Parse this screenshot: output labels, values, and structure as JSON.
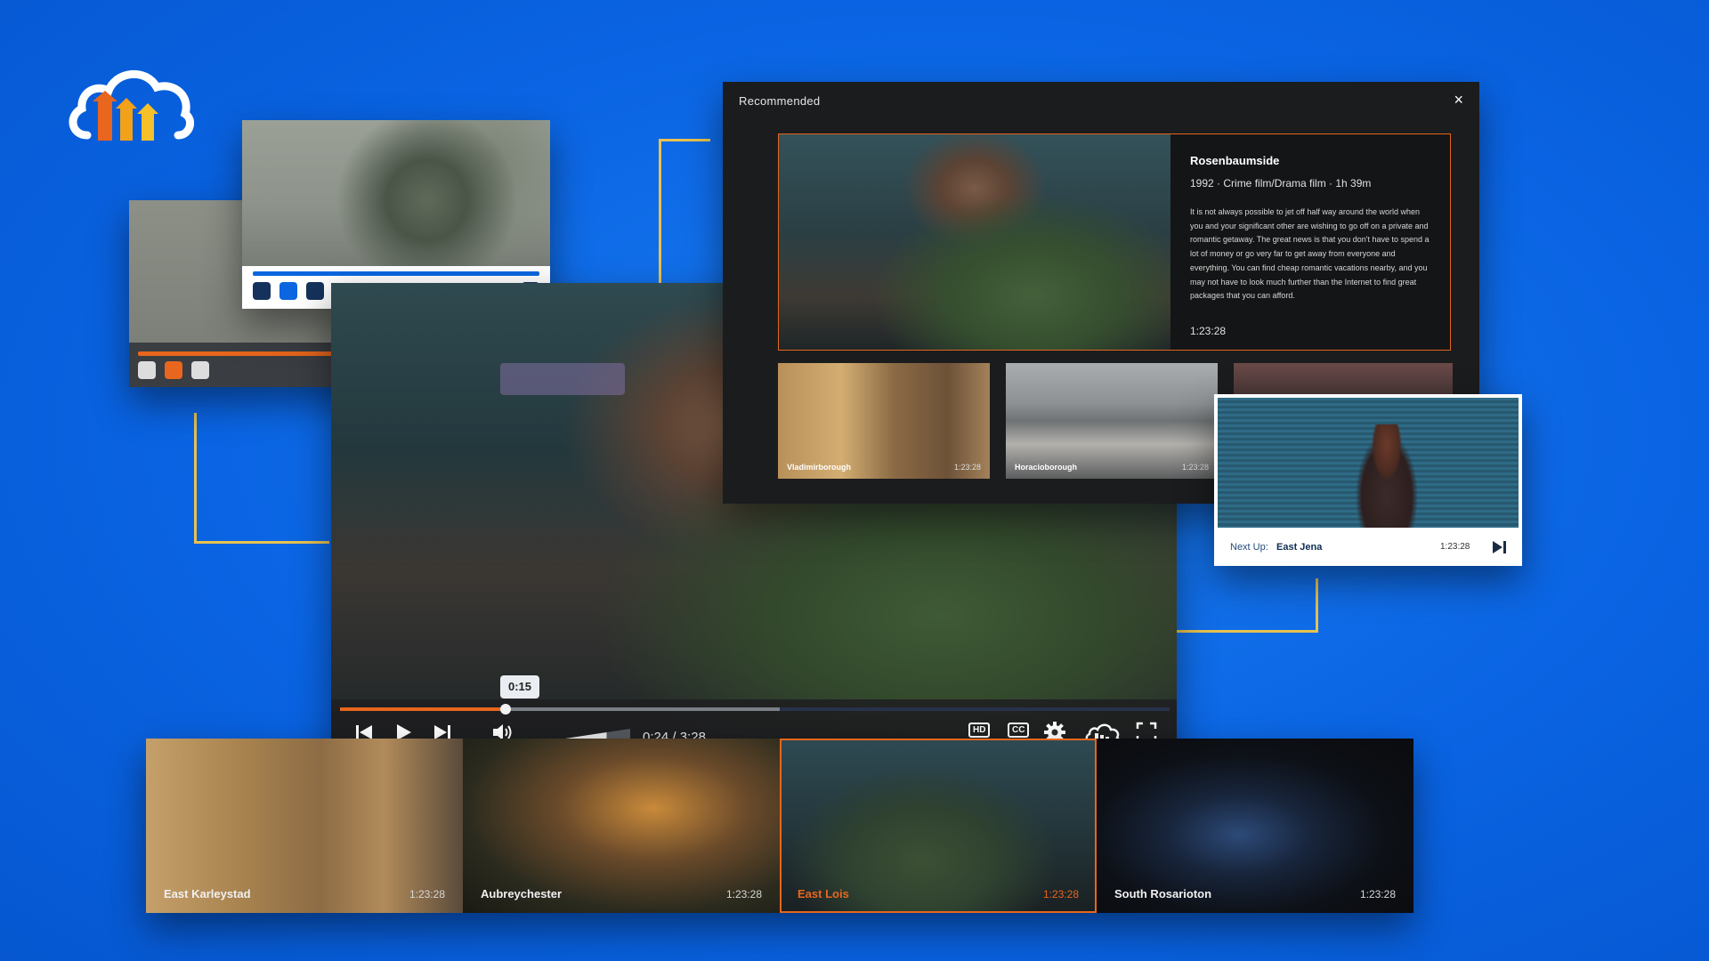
{
  "colors": {
    "background": "#0a64e3",
    "accent_orange": "#e8661d",
    "accent_blue": "#0b66e0",
    "connector_line": "#e8c24f",
    "panel_dark": "#1b1c1e"
  },
  "main_player": {
    "scrub_tooltip": "0:15",
    "current_time": "0:24",
    "separator": "/",
    "total_time": "3:28",
    "progress_fraction": 0.2,
    "buffer_fraction": 0.53,
    "volume_fraction": 0.75,
    "icons": [
      "skip-back-icon",
      "play-icon",
      "skip-forward-icon",
      "volume-icon",
      "hd-icon",
      "cc-icon",
      "gear-icon",
      "cloud-logo-icon",
      "fullscreen-icon"
    ],
    "hd_label": "HD",
    "cc_label": "CC"
  },
  "recommended": {
    "title": "Recommended",
    "close_glyph": "×",
    "feature": {
      "title": "Rosenbaumside",
      "meta": "1992 · Crime film/Drama film · 1h 39m",
      "description": "It is not always possible to jet off half way around the world when you and your significant other are wishing to go off on a private and romantic getaway. The great news is that you don't have to spend a lot of money or go very far to get away from everyone and everything. You can find cheap romantic vacations nearby, and you may not have to look much further than the Internet to find great packages that you can afford.",
      "duration": "1:23:28"
    },
    "thumbnails": [
      {
        "title": "Vladimirborough",
        "duration": "1:23:28"
      },
      {
        "title": "Horacioborough",
        "duration": "1:23:28"
      }
    ]
  },
  "next_up": {
    "label": "Next Up:",
    "title": "East Jena",
    "duration": "1:23:28"
  },
  "playlist": [
    {
      "title": "East Karleystad",
      "duration": "1:23:28",
      "active": false
    },
    {
      "title": "Aubreychester",
      "duration": "1:23:28",
      "active": false
    },
    {
      "title": "East Lois",
      "duration": "1:23:28",
      "active": true
    },
    {
      "title": "South Rosarioton",
      "duration": "1:23:28",
      "active": false
    }
  ]
}
